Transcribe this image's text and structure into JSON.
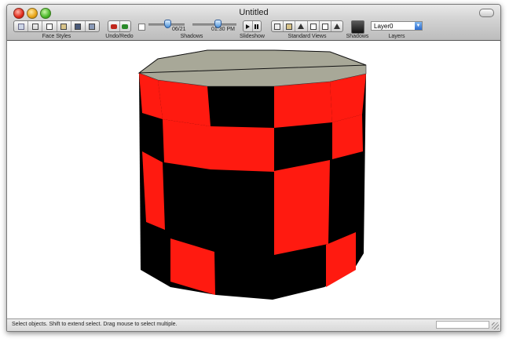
{
  "window": {
    "title": "Untitled"
  },
  "toolbar": {
    "face_styles_label": "Face Styles",
    "undo_redo_label": "Undo/Redo",
    "shadows_slider": {
      "date": "06/21",
      "time": "01:30 PM",
      "label": "Shadows"
    },
    "slideshow_label": "Slideshow",
    "standard_views_label": "Standard Views",
    "shadows_toggle_label": "Shadows",
    "layers": {
      "label": "Layers",
      "selected": "Layer0"
    }
  },
  "status_bar": {
    "text": "Select objects. Shift to extend select. Drag mouse to select multiple."
  },
  "colors": {
    "red": "#ff1a10",
    "black": "#000000",
    "top": "#a8a898"
  }
}
